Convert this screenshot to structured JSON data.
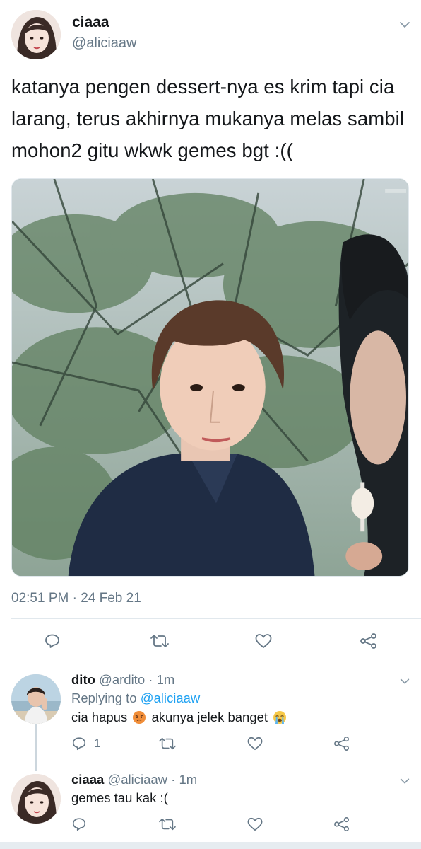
{
  "main_tweet": {
    "display_name": "ciaaa",
    "handle": "@aliciaaw",
    "text": "katanya pengen dessert-nya es krim tapi cia larang, terus akhirnya mukanya melas sambil mohon2 gitu wkwk gemes bgt :((",
    "timestamp": "02:51 PM · 24 Feb 21",
    "actions": [
      "reply-icon",
      "retweet-icon",
      "like-icon",
      "share-icon"
    ]
  },
  "replies": [
    {
      "display_name": "dito",
      "handle": "@ardito",
      "time": "1m",
      "separator": "·",
      "replying_to_label": "Replying to",
      "replying_to_handle": "@aliciaaw",
      "text_part1": "cia hapus",
      "text_part2": "akunya jelek banget",
      "emojis": [
        "angry-face",
        "loudly-crying-face"
      ],
      "reply_count": "1"
    },
    {
      "display_name": "ciaaa",
      "handle": "@aliciaaw",
      "time": "1m",
      "separator": "·",
      "text": "gemes tau kak :("
    }
  ],
  "colors": {
    "text": "#14171a",
    "secondary": "#657786",
    "link": "#1da1f2",
    "border": "#e1e8ed"
  }
}
